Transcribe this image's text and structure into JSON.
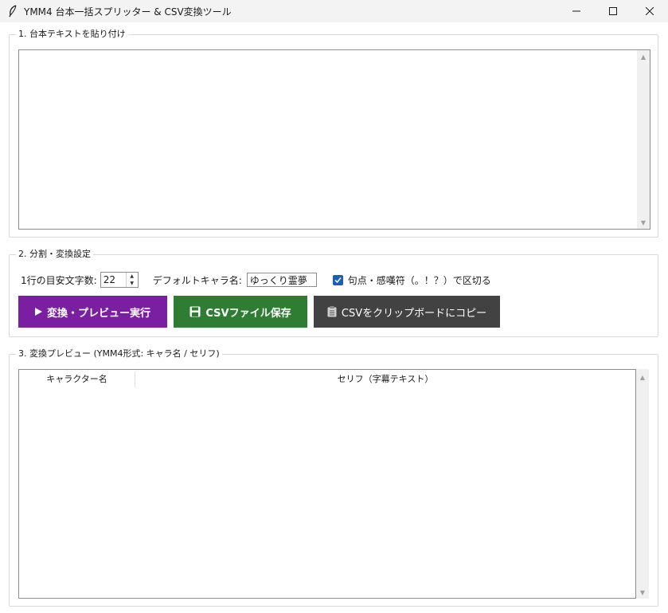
{
  "window": {
    "title": "YMM4 台本一括スプリッター & CSV変換ツール",
    "icon": "feather-icon"
  },
  "section1": {
    "label": "1. 台本テキストを貼り付け",
    "text": ""
  },
  "section2": {
    "label": "2. 分割・変換設定",
    "chars_label": "1行の目安文字数:",
    "chars_value": "22",
    "default_char_label": "デフォルトキャラ名:",
    "default_char_value": "ゆっくり霊夢",
    "split_checkbox_label": "句点・感嘆符（。！？）で区切る",
    "split_checked": true,
    "buttons": {
      "preview": "変換・プレビュー実行",
      "save_csv": "CSVファイル保存",
      "copy_csv": "CSVをクリップボードにコピー"
    },
    "colors": {
      "preview": "#7a1fa2",
      "save_csv": "#2e7d32",
      "copy_csv": "#424242"
    }
  },
  "section3": {
    "label": "3. 変換プレビュー (YMM4形式: キャラ名 / セリフ)",
    "columns": [
      "キャラクター名",
      "セリフ（字幕テキスト）"
    ],
    "rows": []
  }
}
